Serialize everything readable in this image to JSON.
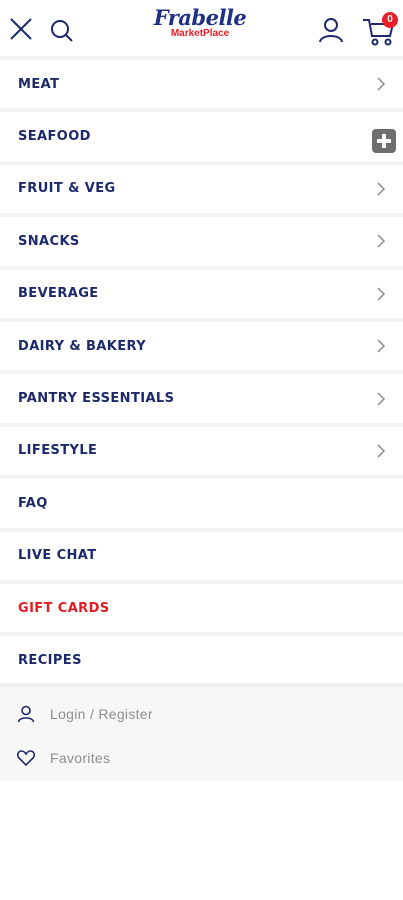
{
  "header": {
    "logo_main": "Frabelle",
    "logo_sub": "MarketPlace",
    "cart_count": "0"
  },
  "menu": {
    "items": [
      {
        "label": "MEAT",
        "has_chevron": true
      },
      {
        "label": "SEAFOOD",
        "has_chevron": false
      },
      {
        "label": "FRUIT & VEG",
        "has_chevron": true
      },
      {
        "label": "SNACKS",
        "has_chevron": true
      },
      {
        "label": "BEVERAGE",
        "has_chevron": true
      },
      {
        "label": "DAIRY & BAKERY",
        "has_chevron": true
      },
      {
        "label": "PANTRY ESSENTIALS",
        "has_chevron": true
      },
      {
        "label": "LIFESTYLE",
        "has_chevron": true
      },
      {
        "label": "FAQ",
        "has_chevron": false
      },
      {
        "label": "LIVE CHAT",
        "has_chevron": false
      },
      {
        "label": "GIFT CARDS",
        "has_chevron": false
      },
      {
        "label": "RECIPES",
        "has_chevron": false
      }
    ]
  },
  "account": {
    "login_label": "Login / Register",
    "favorites_label": "Favorites"
  },
  "colors": {
    "navy": "#1c2a6b",
    "red": "#e41b23",
    "muted": "#8e8e8e"
  },
  "icons": [
    "close-icon",
    "search-icon",
    "user-icon",
    "cart-icon",
    "chevron-right-icon",
    "plus-icon",
    "heart-icon"
  ]
}
